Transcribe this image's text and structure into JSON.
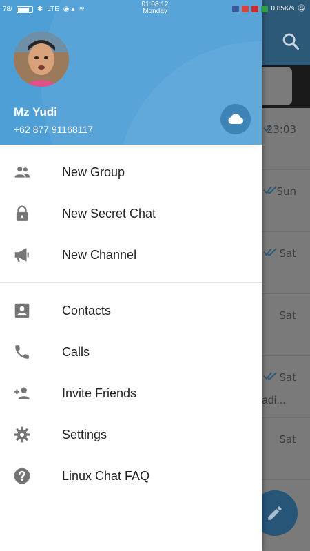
{
  "status_bar": {
    "left_text": "78/",
    "network": "LTE",
    "time": "01:08:12",
    "day": "Monday",
    "speed": "0,85K/s"
  },
  "drawer": {
    "user": {
      "name": "Mz Yudi",
      "phone": "+62 877 91168117"
    },
    "menu_group_1": [
      {
        "label": "New Group",
        "icon": "group-icon"
      },
      {
        "label": "New Secret Chat",
        "icon": "lock-icon"
      },
      {
        "label": "New Channel",
        "icon": "megaphone-icon"
      }
    ],
    "menu_group_2": [
      {
        "label": "Contacts",
        "icon": "contact-card-icon"
      },
      {
        "label": "Calls",
        "icon": "phone-icon"
      },
      {
        "label": "Invite Friends",
        "icon": "add-person-icon"
      },
      {
        "label": "Settings",
        "icon": "gear-icon"
      },
      {
        "label": "Linux Chat FAQ",
        "icon": "help-icon"
      }
    ]
  },
  "background_list": {
    "rows": [
      {
        "time": "23:03",
        "preview": ""
      },
      {
        "time": "Sun",
        "preview": ""
      },
      {
        "time": "Sat",
        "preview": ""
      },
      {
        "time": "Sat",
        "preview": ""
      },
      {
        "time": "Sat",
        "preview": "adi..."
      },
      {
        "time": "Sat",
        "preview": ""
      }
    ]
  },
  "colors": {
    "header_blue": "#4e9fd6",
    "app_bar": "#2d5978",
    "icon_gray": "#757575"
  }
}
